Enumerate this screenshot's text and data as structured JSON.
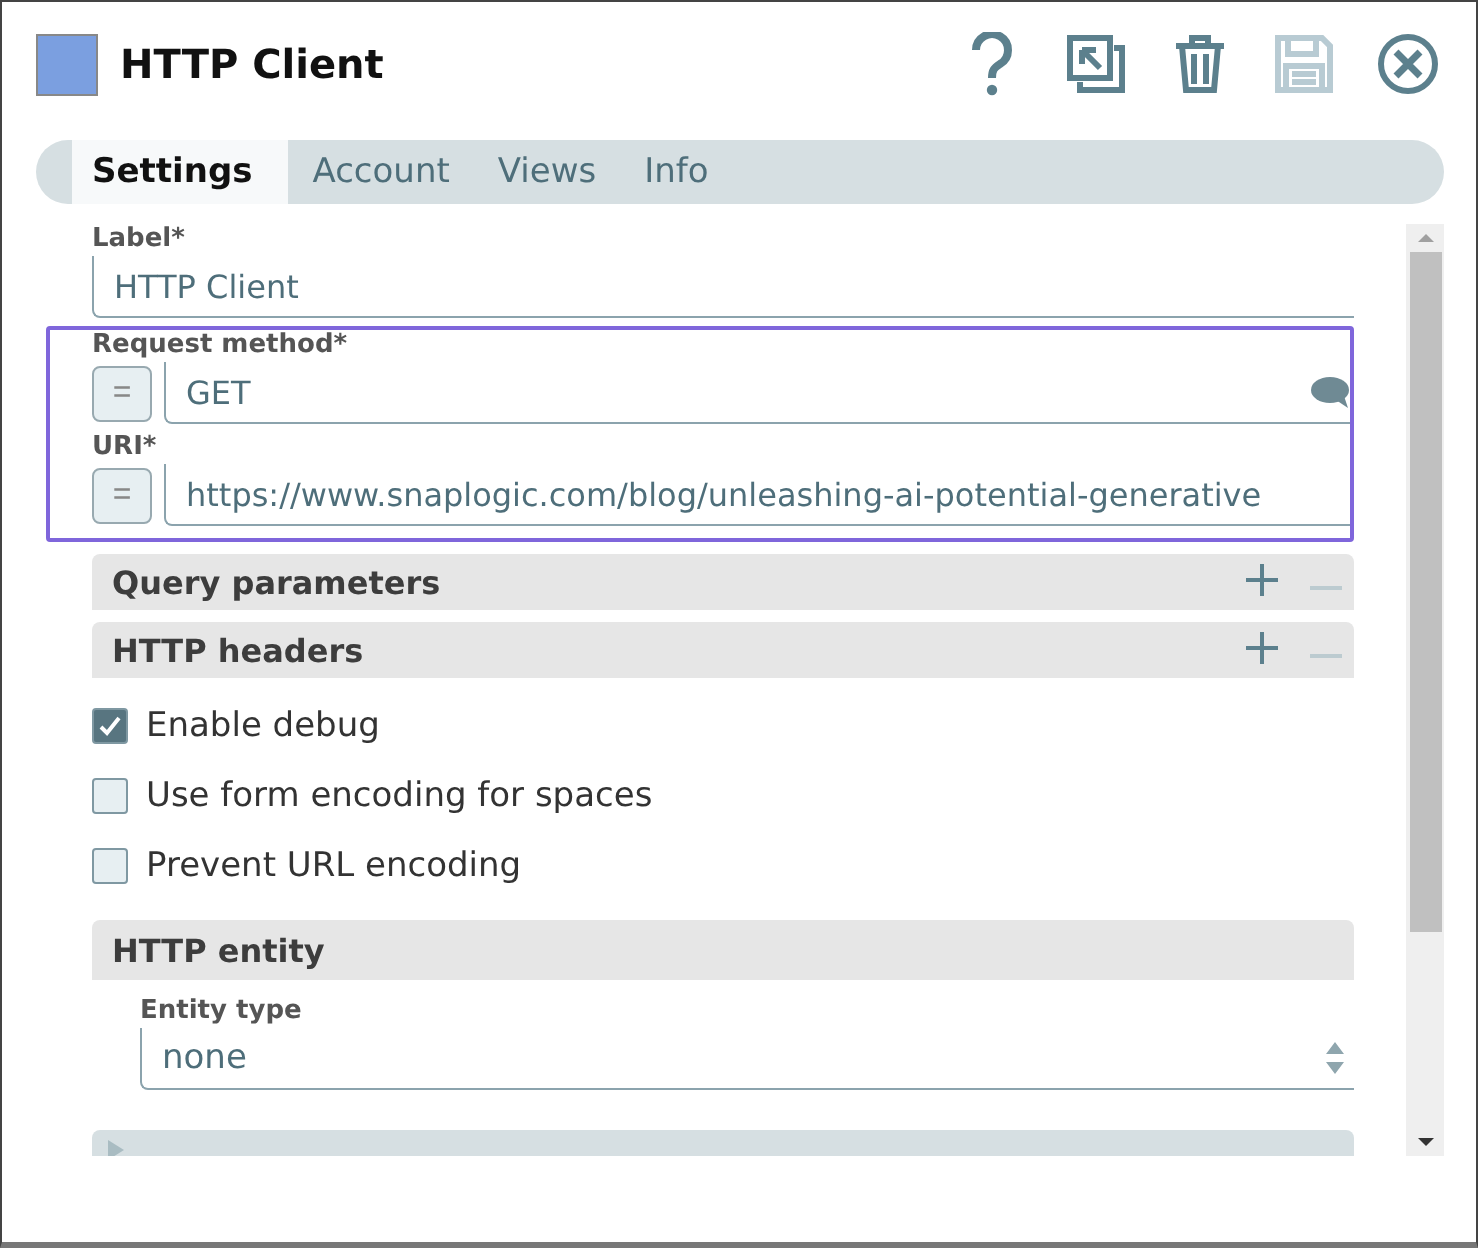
{
  "window": {
    "title": "HTTP Client",
    "color": "#7b9fe0"
  },
  "toolbar": [
    {
      "kind": "help",
      "disabled": false
    },
    {
      "kind": "expand",
      "disabled": false
    },
    {
      "kind": "delete",
      "disabled": false
    },
    {
      "kind": "save",
      "disabled": true
    },
    {
      "kind": "close",
      "disabled": false
    }
  ],
  "tabs": [
    {
      "label": "Settings",
      "selected": true
    },
    {
      "label": "Account",
      "selected": false
    },
    {
      "label": "Views",
      "selected": false
    },
    {
      "label": "Info",
      "selected": false
    }
  ],
  "fields": [
    {
      "label": "Label*",
      "value": "HTTP Client",
      "expression": false,
      "highlighted": false
    },
    {
      "label": "Request method*",
      "value": "GET",
      "expression": "=",
      "highlighted": true,
      "comment": true
    },
    {
      "label": "URI*",
      "value": "https://www.snaplogic.com/blog/unleashing-ai-potential-generative",
      "expression": "=",
      "highlighted": true
    }
  ],
  "tables": [
    {
      "label": "Query parameters"
    },
    {
      "label": "HTTP headers"
    }
  ],
  "checkboxes": [
    {
      "label": "Enable debug",
      "checked": true
    },
    {
      "label": "Use form encoding for spaces",
      "checked": false
    },
    {
      "label": "Prevent URL encoding",
      "checked": false
    }
  ],
  "entity": {
    "title": "HTTP entity",
    "field_label": "Entity type",
    "value": "none"
  }
}
